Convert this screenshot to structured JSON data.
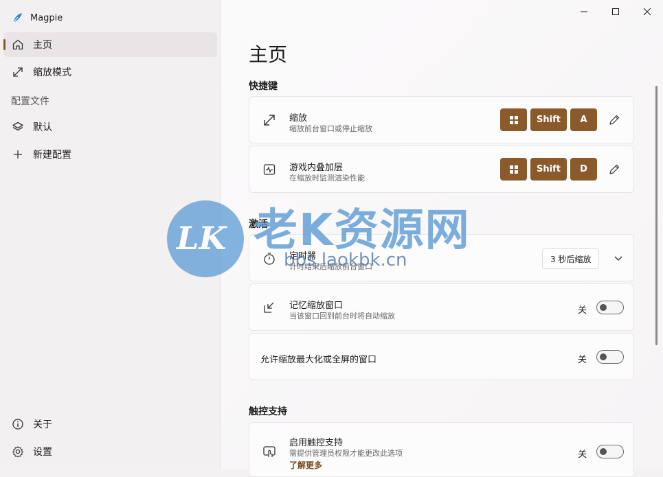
{
  "app": {
    "title": "Magpie"
  },
  "sidebar": {
    "items": [
      {
        "label": "主页",
        "icon": "home-icon"
      },
      {
        "label": "缩放模式",
        "icon": "resize-icon"
      }
    ],
    "profiles_section": "配置文件",
    "profiles": [
      {
        "label": "默认",
        "icon": "layers-icon"
      },
      {
        "label": "新建配置",
        "icon": "plus-icon"
      }
    ],
    "footer": [
      {
        "label": "关于",
        "icon": "info-icon"
      },
      {
        "label": "设置",
        "icon": "gear-icon"
      }
    ]
  },
  "main": {
    "title": "主页",
    "sections": {
      "shortcuts": "快捷键",
      "activation": "激活",
      "touch": "触控支持"
    },
    "shortcuts": [
      {
        "title": "缩放",
        "subtitle": "缩放前台窗口或停止缩放",
        "keys": [
          "Win",
          "Shift",
          "A"
        ]
      },
      {
        "title": "游戏内叠加层",
        "subtitle": "在缩放时监测渲染性能",
        "keys": [
          "Win",
          "Shift",
          "D"
        ]
      }
    ],
    "activation": {
      "timer": {
        "title": "定时器",
        "subtitle": "计时结束后缩放前台窗口",
        "value": "3 秒后缩放"
      },
      "remember": {
        "title": "记忆缩放窗口",
        "subtitle": "当该窗口回到前台时将自动缩放",
        "state": "关"
      },
      "allow_max": {
        "title": "允许缩放最大化或全屏的窗口",
        "state": "关"
      }
    },
    "touch": {
      "title": "启用触控支持",
      "subtitle": "需提供管理员权限才能更改此选项",
      "link": "了解更多",
      "state": "关"
    }
  },
  "watermark": {
    "text": "老K资源网",
    "logo": "LK",
    "url": "bbs.laokbk.cn"
  },
  "colors": {
    "accent": "#8b5a2b",
    "watermark": "#5b9bd5"
  }
}
